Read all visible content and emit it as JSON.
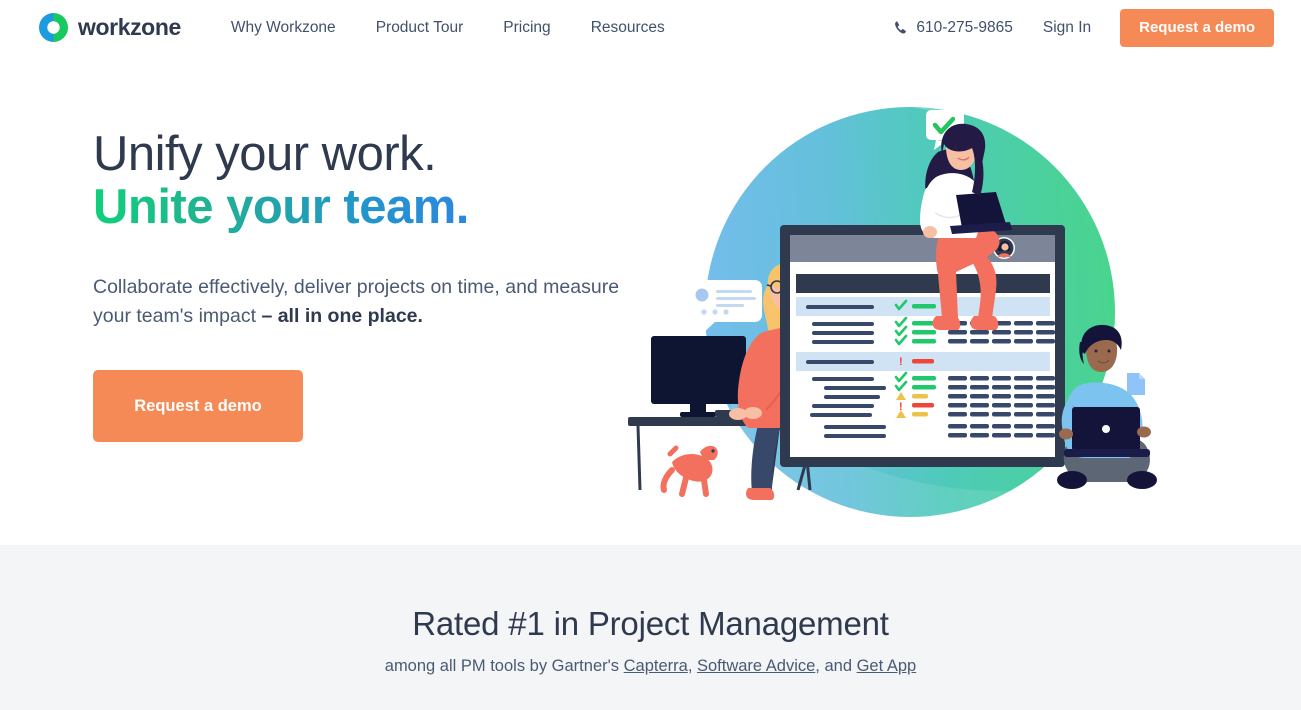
{
  "header": {
    "logo": {
      "text": "workzone",
      "icon": "workzone-circle-logo"
    },
    "nav": [
      {
        "label": "Why Workzone"
      },
      {
        "label": "Product Tour"
      },
      {
        "label": "Pricing"
      },
      {
        "label": "Resources"
      }
    ],
    "phone": {
      "number": "610-275-9865",
      "icon": "phone-icon"
    },
    "sign_in": "Sign In",
    "cta": "Request a demo",
    "cta_color": "#f58a56"
  },
  "hero": {
    "heading_line1": "Unify your work.",
    "heading_line2": "Unite your team.",
    "heading_line1_color": "#2f3a4f",
    "heading_line2_gradient_from": "#0fd07b",
    "heading_line2_gradient_to": "#2f86e0",
    "sub_plain": "Collaborate effectively, deliver projects on time, and measure your team's impact ",
    "sub_bold": "– all in one place.",
    "cta": "Request a demo",
    "illustration": {
      "name": "team-collaboration-dashboard-illustration",
      "bg_blue": "#67b2e8",
      "bg_green": "#4fd18e",
      "accent_coral": "#f4705e",
      "accent_dark": "#2f3a4f",
      "rows": [
        {
          "status": "check",
          "bar": "green",
          "highlight": true,
          "cells": 0
        },
        {
          "status": "check",
          "bar": "green",
          "highlight": false,
          "cells": 5
        },
        {
          "status": "check",
          "bar": "green",
          "highlight": false,
          "cells": 5
        },
        {
          "status": "check",
          "bar": "green",
          "highlight": false,
          "cells": 5
        },
        {
          "status": "alert",
          "bar": "red",
          "highlight": true,
          "cells": 0
        },
        {
          "status": "check",
          "bar": "green",
          "highlight": false,
          "cells": 5
        },
        {
          "status": "check",
          "bar": "green",
          "highlight": false,
          "cells": 5
        },
        {
          "status": "warn",
          "bar": "yellow",
          "highlight": false,
          "cells": 5
        },
        {
          "status": "alert",
          "bar": "red",
          "highlight": false,
          "cells": 5
        },
        {
          "status": "warn",
          "bar": "yellow",
          "highlight": false,
          "cells": 5
        },
        {
          "status": "none",
          "bar": "none",
          "highlight": false,
          "cells": 5
        },
        {
          "status": "none",
          "bar": "none",
          "highlight": false,
          "cells": 5
        }
      ]
    }
  },
  "band": {
    "title": "Rated #1 in Project Management",
    "sub_prefix": "among all PM tools by Gartner's ",
    "link1": "Capterra",
    "sep1": ", ",
    "link2": "Software Advice",
    "sep2": ", and ",
    "link3": "Get App",
    "bg": "#f4f5f7"
  }
}
